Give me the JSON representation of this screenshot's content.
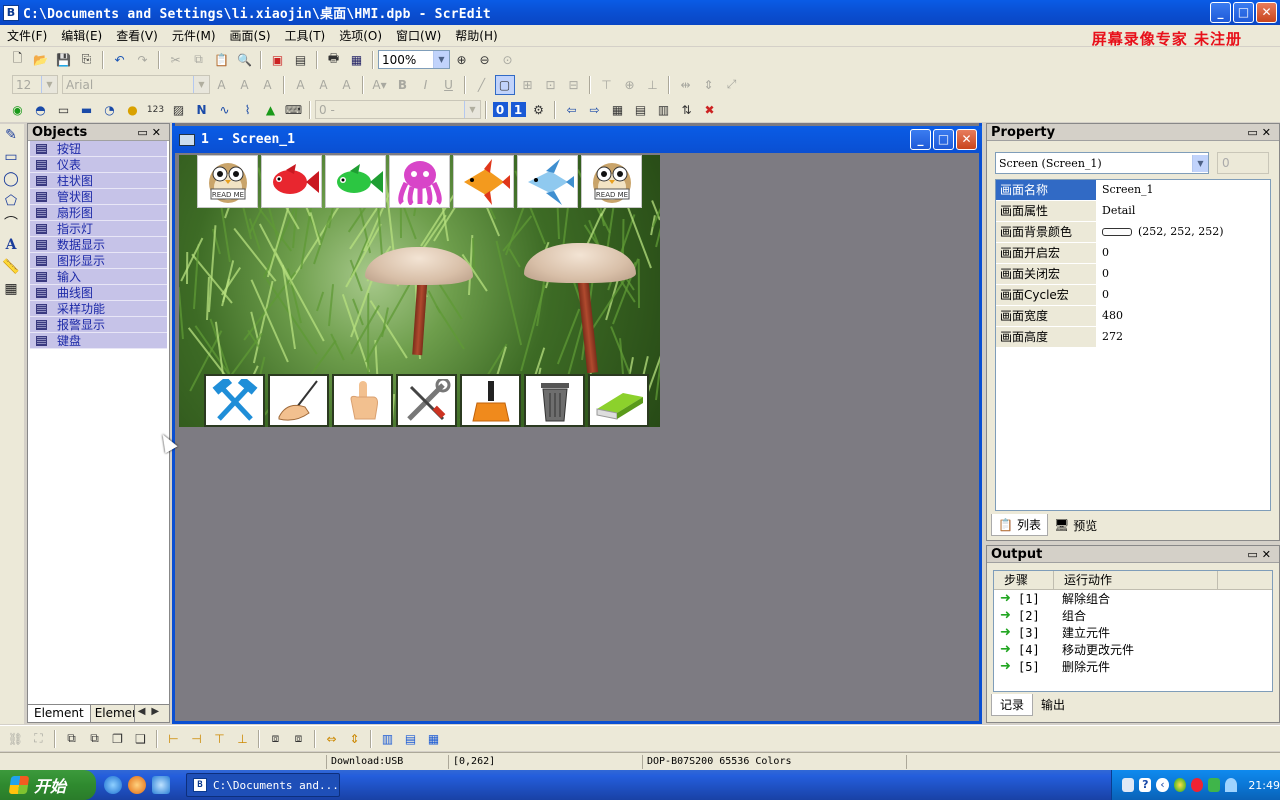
{
  "window": {
    "title": "C:\\Documents and Settings\\li.xiaojin\\桌面\\HMI.dpb - ScrEdit",
    "min": "_",
    "max": "□",
    "close": "✕"
  },
  "menu": [
    "文件(F)",
    "编辑(E)",
    "查看(V)",
    "元件(M)",
    "画面(S)",
    "工具(T)",
    "选项(O)",
    "窗口(W)",
    "帮助(H)"
  ],
  "watermark": "屏幕录像专家  未注册",
  "toolbar": {
    "zoom": "100%",
    "font_size": "12",
    "font_name": "Arial",
    "state_combo": "0 -"
  },
  "objects_panel": {
    "title": "Objects",
    "items": [
      "按钮",
      "仪表",
      "柱状图",
      "管状图",
      "扇形图",
      "指示灯",
      "数据显示",
      "图形显示",
      "输入",
      "曲线图",
      "采样功能",
      "报警显示",
      "键盘"
    ],
    "tab_active": "Element",
    "tab_other": "Element"
  },
  "screen_window": {
    "title": "1 - Screen_1"
  },
  "property_panel": {
    "title": "Property",
    "object_select": "Screen (Screen_1)",
    "spin_value": "0",
    "rows": [
      {
        "key": "画面名称",
        "value": "Screen_1"
      },
      {
        "key": "画面属性",
        "value": "Detail"
      },
      {
        "key": "画面背景颜色",
        "value": "(252, 252, 252)"
      },
      {
        "key": "画面开启宏",
        "value": "0"
      },
      {
        "key": "画面关闭宏",
        "value": "0"
      },
      {
        "key": "画面Cycle宏",
        "value": "0"
      },
      {
        "key": "画面宽度",
        "value": "480"
      },
      {
        "key": "画面高度",
        "value": "272"
      }
    ],
    "tabs": [
      "列表",
      "预览"
    ],
    "bg_color": "#fcfcfc"
  },
  "output_panel": {
    "title": "Output",
    "col_step": "步骤",
    "col_action": "运行动作",
    "rows": [
      {
        "step": "[1]",
        "action": "解除组合"
      },
      {
        "step": "[2]",
        "action": "组合"
      },
      {
        "step": "[3]",
        "action": "建立元件"
      },
      {
        "step": "[4]",
        "action": "移动更改元件"
      },
      {
        "step": "[5]",
        "action": "删除元件"
      }
    ],
    "tabs": [
      "记录",
      "输出"
    ]
  },
  "status": {
    "download": "Download:USB",
    "coords": "[0,262]",
    "model": "DOP-B07S200 65536 Colors"
  },
  "taskbar": {
    "start": "开始",
    "task": "C:\\Documents and...",
    "clock": "21:49"
  }
}
